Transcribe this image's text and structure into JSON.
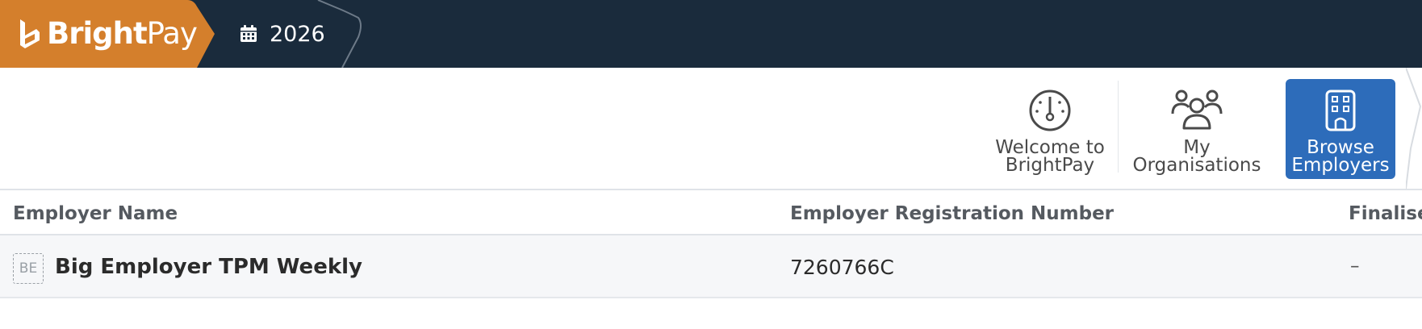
{
  "brand": {
    "name_bold": "Bright",
    "name_light": "Pay",
    "accent_color": "#d47f2c",
    "bar_color": "#1a2b3c"
  },
  "year_tab": {
    "icon": "calendar-icon",
    "label": "2026"
  },
  "toolbar": {
    "welcome": {
      "icon": "clock-dial-icon",
      "label": "Welcome to\nBrightPay"
    },
    "organisations": {
      "icon": "people-group-icon",
      "label": "My\nOrganisations"
    },
    "browse": {
      "icon": "building-icon",
      "label": "Browse\nEmployers",
      "active_color": "#2d6cba"
    }
  },
  "table": {
    "columns": [
      "Employer Name",
      "Employer Registration Number",
      "Finalised"
    ],
    "rows": [
      {
        "avatar": "BE",
        "name": "Big Employer TPM Weekly",
        "registration_number": "7260766C",
        "finalised": "–"
      }
    ]
  }
}
